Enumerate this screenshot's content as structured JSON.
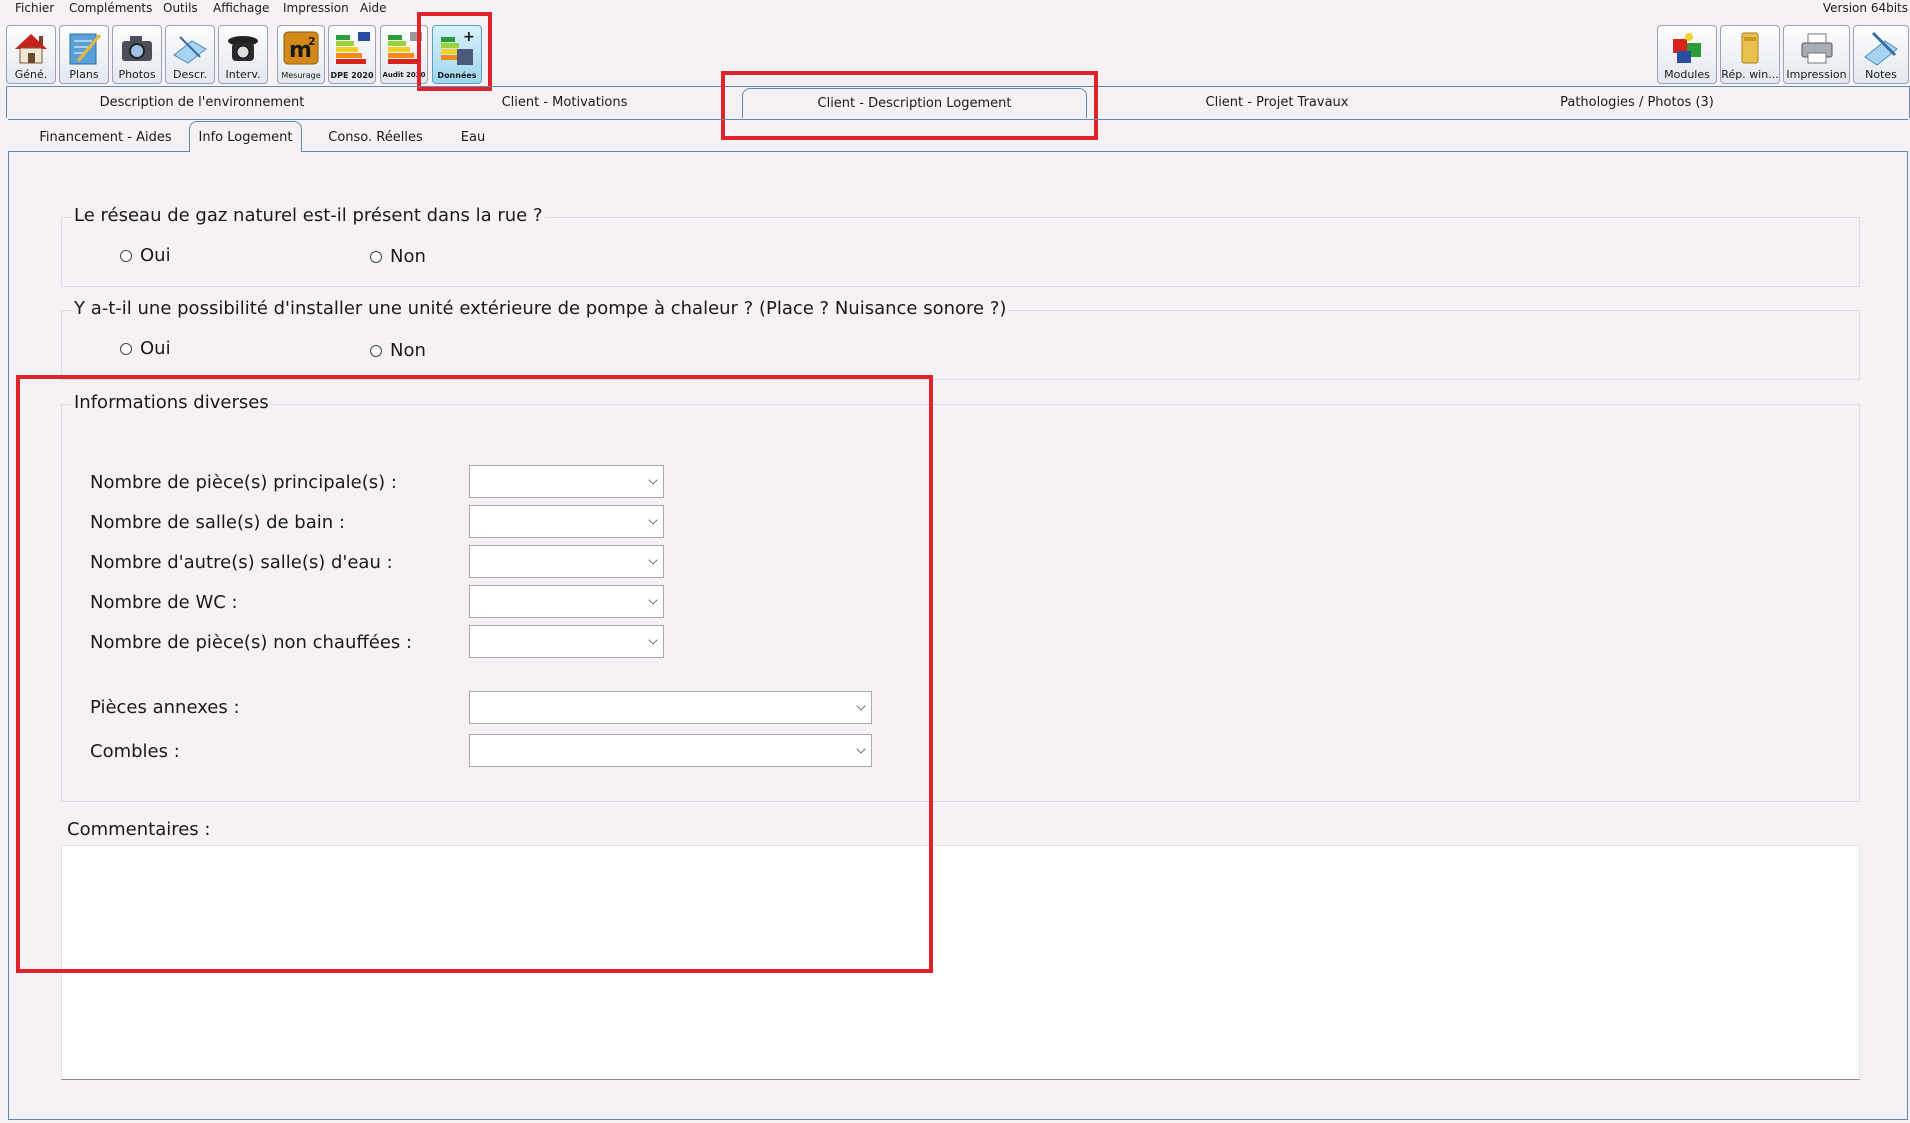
{
  "menu": [
    "Fichier",
    "Compléments",
    "Outils",
    "Affichage",
    "Impression",
    "Aide"
  ],
  "version": "Version 64bits",
  "toolbar_left": [
    {
      "label": "Géné.",
      "icon": "house-icon"
    },
    {
      "label": "Plans",
      "icon": "plans-icon"
    },
    {
      "label": "Photos",
      "icon": "camera-icon"
    },
    {
      "label": "Descr.",
      "icon": "description-icon"
    },
    {
      "label": "Interv.",
      "icon": "phone-icon"
    },
    {
      "label": "Mesurage",
      "icon": "m2-icon"
    },
    {
      "label": "DPE 2020",
      "icon": "dpe-icon"
    },
    {
      "label": "Audit 2020",
      "icon": "audit-icon"
    },
    {
      "label": "Données",
      "icon": "donnees-icon"
    }
  ],
  "toolbar_right": [
    {
      "label": "Modules",
      "icon": "puzzle-icon"
    },
    {
      "label": "Rép. win...",
      "icon": "folder-icon"
    },
    {
      "label": "Impression",
      "icon": "printer-icon"
    },
    {
      "label": "Notes",
      "icon": "notes-icon"
    }
  ],
  "main_tabs": [
    "Description de l'environnement",
    "Client - Motivations",
    "Client - Description Logement",
    "Client - Projet Travaux",
    "Pathologies / Photos (3)"
  ],
  "active_main_tab": "Client - Description Logement",
  "sub_tabs": [
    "Financement - Aides",
    "Info Logement",
    "Conso. Réelles",
    "Eau"
  ],
  "active_sub_tab": "Info Logement",
  "gas_question": {
    "legend": "Le réseau de gaz naturel est-il présent dans la rue ?",
    "yes": "Oui",
    "no": "Non"
  },
  "heatpump_question": {
    "legend": "Y a-t-il une possibilité d'installer une unité extérieure de pompe à chaleur ? (Place ? Nuisance sonore ?)",
    "yes": "Oui",
    "no": "Non"
  },
  "info_group": {
    "legend": "Informations diverses",
    "fields": [
      {
        "label": "Nombre de pièce(s) principale(s) :",
        "value": ""
      },
      {
        "label": "Nombre de salle(s) de bain :",
        "value": ""
      },
      {
        "label": "Nombre d'autre(s) salle(s) d'eau :",
        "value": ""
      },
      {
        "label": "Nombre de WC :",
        "value": ""
      },
      {
        "label": "Nombre de pièce(s) non chauffées :",
        "value": ""
      }
    ],
    "annexes_label": "Pièces annexes :",
    "annexes_value": "",
    "combles_label": "Combles :",
    "combles_value": ""
  },
  "comments_label": "Commentaires :",
  "comments_value": "",
  "highlight_color": "#e0232a"
}
